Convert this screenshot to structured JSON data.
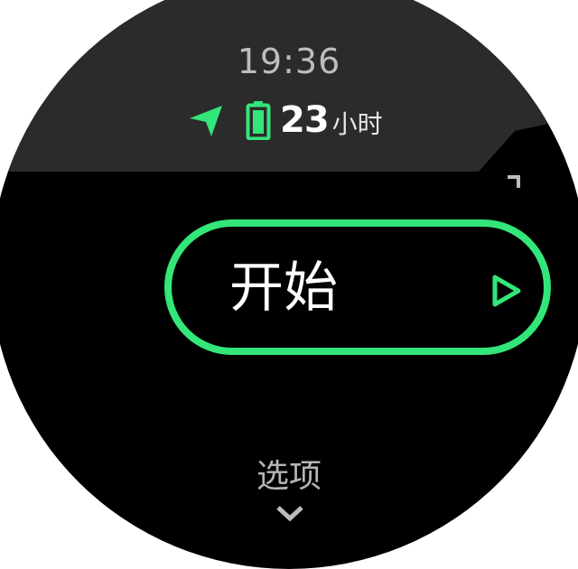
{
  "status": {
    "time": "19:36",
    "battery_value": "23",
    "battery_unit": "小时"
  },
  "menu": {
    "start_label": "开始",
    "options_label": "选项"
  },
  "icons": {
    "gps": "gps-arrow-icon",
    "battery": "battery-icon",
    "scroll_up": "chevron-up-icon",
    "play": "play-icon",
    "scroll_down": "chevron-down-icon"
  },
  "colors": {
    "accent": "#33e67a",
    "top_band": "#2b2b2b",
    "background": "#000000"
  }
}
